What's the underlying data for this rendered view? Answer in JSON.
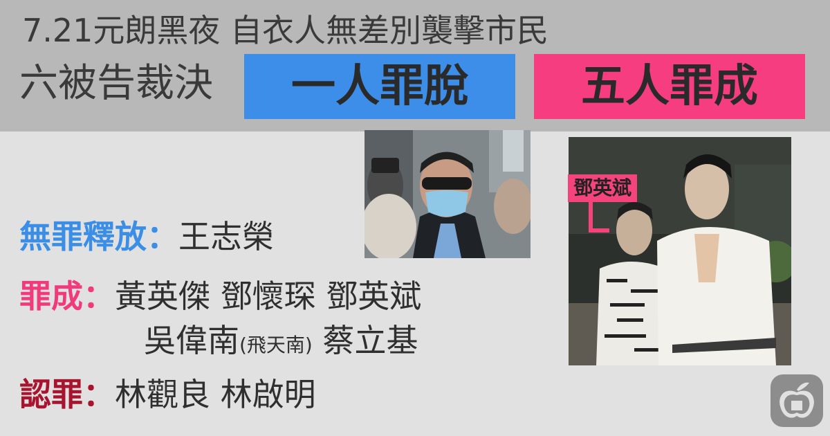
{
  "header": {
    "line1": "7.21元朗黑夜 自衣人無差別襲擊市民",
    "line2": "六被告裁決",
    "verdict_acquitted": "一人罪脫",
    "verdict_convicted": "五人罪成"
  },
  "acquitted": {
    "label": "無罪釋放：",
    "names": "王志榮"
  },
  "convicted": {
    "label": "罪成：",
    "names_line1": "黃英傑 鄧懷琛 鄧英斌",
    "names_line2_a": "吳偉南",
    "alias": "(飛天南)",
    "names_line2_b": " 蔡立基"
  },
  "pleaded": {
    "label": "認罪：",
    "names": "林觀良 林啟明"
  },
  "photo_tag": "鄧英斌",
  "colors": {
    "header_bg": "#b8b8b8",
    "page_bg": "#e1e1e1",
    "blue": "#3c8ee8",
    "pink": "#f53d80",
    "dark_red": "#a8132e"
  },
  "icons": {
    "logo": "apple-daily-logo-icon"
  }
}
